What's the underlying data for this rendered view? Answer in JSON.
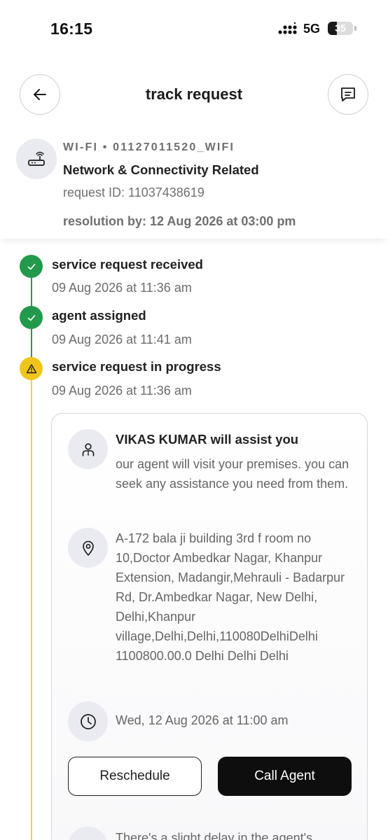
{
  "status_bar": {
    "time": "16:15",
    "network": "5G",
    "battery": "35",
    "battery_level_percent": 35,
    "icons": [
      "signal-icon",
      "battery-icon"
    ]
  },
  "header": {
    "title": "track request",
    "icons": [
      "back-arrow-icon",
      "chat-icon"
    ]
  },
  "summary": {
    "category_line": "WI-FI • 01127011520_WIFI",
    "title": "Network & Connectivity Related",
    "request_id": "request ID: 11037438619",
    "resolution": "resolution by: 12 Aug 2026 at 03:00 pm",
    "icon": "router-icon"
  },
  "timeline": {
    "colors": {
      "done": "#22994b",
      "in_progress": "#f0c51b"
    },
    "steps": [
      {
        "title": "service request received",
        "time": "09 Aug 2026 at 11:36 am",
        "state": "done",
        "icon": "check-icon"
      },
      {
        "title": "agent assigned",
        "time": "09 Aug 2026 at 11:41 am",
        "state": "done",
        "icon": "check-icon"
      },
      {
        "title": "service request in progress",
        "time": "09 Aug 2026 at 11:36 am",
        "state": "in_progress",
        "icon": "warning-icon"
      }
    ]
  },
  "agent_card": {
    "title": "VIKAS KUMAR will assist you",
    "description": "our agent will visit your premises. you can seek any assistance you need from them.",
    "address": "A-172 bala ji building 3rd f room no 10,Doctor Ambedkar Nagar, Khanpur Extension, Madangir,Mehrauli - Badarpur Rd, Dr.Ambedkar Nagar, New Delhi, Delhi,Khanpur village,Delhi,Delhi,110080DelhiDelhi 1100800.00.0 Delhi Delhi Delhi",
    "visit_time": "Wed, 12 Aug 2026 at 11:00 am",
    "reschedule_label": "Reschedule",
    "call_label": "Call Agent",
    "delay_note": "There's a slight delay in the agent's",
    "icons": [
      "person-icon",
      "location-pin-icon",
      "clock-icon",
      "info-icon"
    ]
  }
}
